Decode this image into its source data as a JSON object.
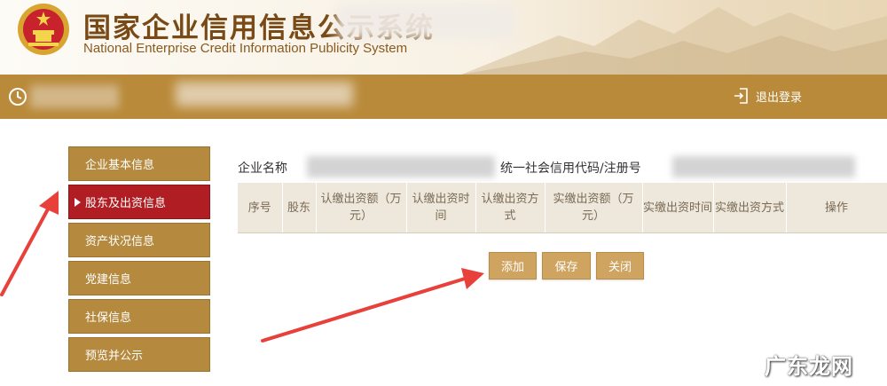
{
  "header": {
    "title_cn": "国家企业信用信息公示系统",
    "title_en": "National Enterprise Credit Information Publicity System"
  },
  "userbar": {
    "logout_label": "退出登录"
  },
  "sidebar": {
    "items": [
      {
        "label": "企业基本信息",
        "active": false
      },
      {
        "label": "股东及出资信息",
        "active": true
      },
      {
        "label": "资产状况信息",
        "active": false
      },
      {
        "label": "党建信息",
        "active": false
      },
      {
        "label": "社保信息",
        "active": false
      },
      {
        "label": "预览并公示",
        "active": false
      }
    ]
  },
  "main": {
    "company_name_label": "企业名称",
    "credit_code_label": "统一社会信用代码/注册号",
    "table_headers": [
      "序号",
      "股东",
      "认缴出资额（万元）",
      "认缴出资时间",
      "认缴出资方式",
      "实缴出资额（万元）",
      "实缴出资时间",
      "实缴出资方式",
      "操作"
    ],
    "buttons": {
      "add": "添加",
      "save": "保存",
      "close": "关闭"
    }
  },
  "watermark": "广东龙网",
  "colors": {
    "header_text": "#7a4a16",
    "userbar": "#b98a3a",
    "sidebar_item": "#b5893e",
    "sidebar_active": "#b01e24",
    "button": "#cfa460",
    "arrow": "#e8403a"
  }
}
